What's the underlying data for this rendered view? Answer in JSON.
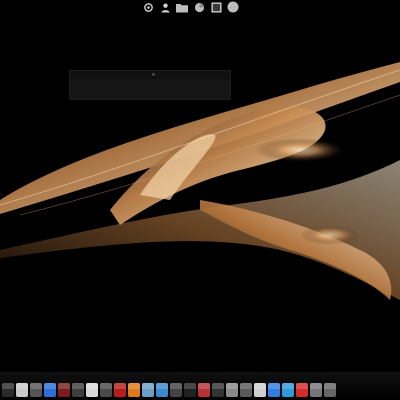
{
  "desktop": {
    "wallpaper": {
      "background": "#000000",
      "accent": "#d89a5c",
      "highlight": "#ffe6c2"
    }
  },
  "top_launcher": {
    "items": [
      {
        "icon": "settings-icon"
      },
      {
        "icon": "user-icon"
      },
      {
        "icon": "folder-icon"
      },
      {
        "icon": "firefox-icon"
      },
      {
        "icon": "terminal-icon"
      },
      {
        "icon": "circle-icon"
      }
    ]
  },
  "dock": {
    "items": [
      {
        "icon": "power-icon",
        "color": "#2b2b2b"
      },
      {
        "icon": "document-icon",
        "color": "#c9c9c9"
      },
      {
        "icon": "gear-icon",
        "color": "#555555"
      },
      {
        "icon": "chrome-icon",
        "color": "#2a6ed6"
      },
      {
        "icon": "photo-icon",
        "color": "#7a1d1d"
      },
      {
        "icon": "calculator-icon",
        "color": "#3d3d3d"
      },
      {
        "icon": "text-editor-icon",
        "color": "#d8d8d8"
      },
      {
        "icon": "mail-icon",
        "color": "#4a4a4a"
      },
      {
        "icon": "pdf-icon",
        "color": "#b91c1c"
      },
      {
        "icon": "firefox-icon",
        "color": "#e07a1a"
      },
      {
        "icon": "search-icon",
        "color": "#6aa0c8"
      },
      {
        "icon": "network-icon",
        "color": "#3a8ad0"
      },
      {
        "icon": "music-icon",
        "color": "#444444"
      },
      {
        "icon": "video-icon",
        "color": "#222222"
      },
      {
        "icon": "video-editor-icon",
        "color": "#b83232"
      },
      {
        "icon": "film-icon",
        "color": "#333333"
      },
      {
        "icon": "image-viewer-icon",
        "color": "#8a8a8a"
      },
      {
        "icon": "disk-icon",
        "color": "#5a5a5a"
      },
      {
        "icon": "printer-icon",
        "color": "#cfcfcf"
      },
      {
        "icon": "app-icon",
        "color": "#2f7fe0"
      },
      {
        "icon": "globe-icon",
        "color": "#2d9bd8"
      },
      {
        "icon": "ftp-icon",
        "color": "#d42b2b"
      },
      {
        "icon": "terminal-icon",
        "color": "#777777"
      },
      {
        "icon": "trash-icon",
        "color": "#666666"
      }
    ]
  }
}
